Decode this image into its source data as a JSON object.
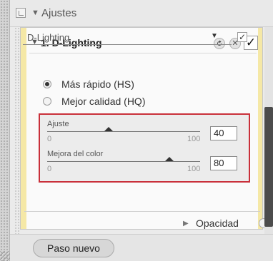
{
  "header": {
    "title": "Ajustes",
    "collapse_icon": "triangle-down-icon"
  },
  "step": {
    "title": "1. D-Lighting",
    "reset_icon": "reset-icon",
    "close_icon": "close-icon",
    "enabled_icon": "checkmark-icon"
  },
  "dropdown": {
    "selected": "D-Lighting"
  },
  "radios": [
    {
      "label": "Más rápido (HS)",
      "checked": true
    },
    {
      "label": "Mejor calidad (HQ)",
      "checked": false
    }
  ],
  "sliders": [
    {
      "label": "Ajuste",
      "min": "0",
      "max": "100",
      "value": "40",
      "value_num": 40
    },
    {
      "label": "Mejora del color",
      "min": "0",
      "max": "100",
      "value": "80",
      "value_num": 80
    }
  ],
  "opacity": {
    "label": "Opacidad"
  },
  "footer": {
    "new_step_label": "Paso nuevo"
  },
  "colors": {
    "highlight_border": "#c9303a",
    "panel_accent": "#f5e8a6"
  }
}
